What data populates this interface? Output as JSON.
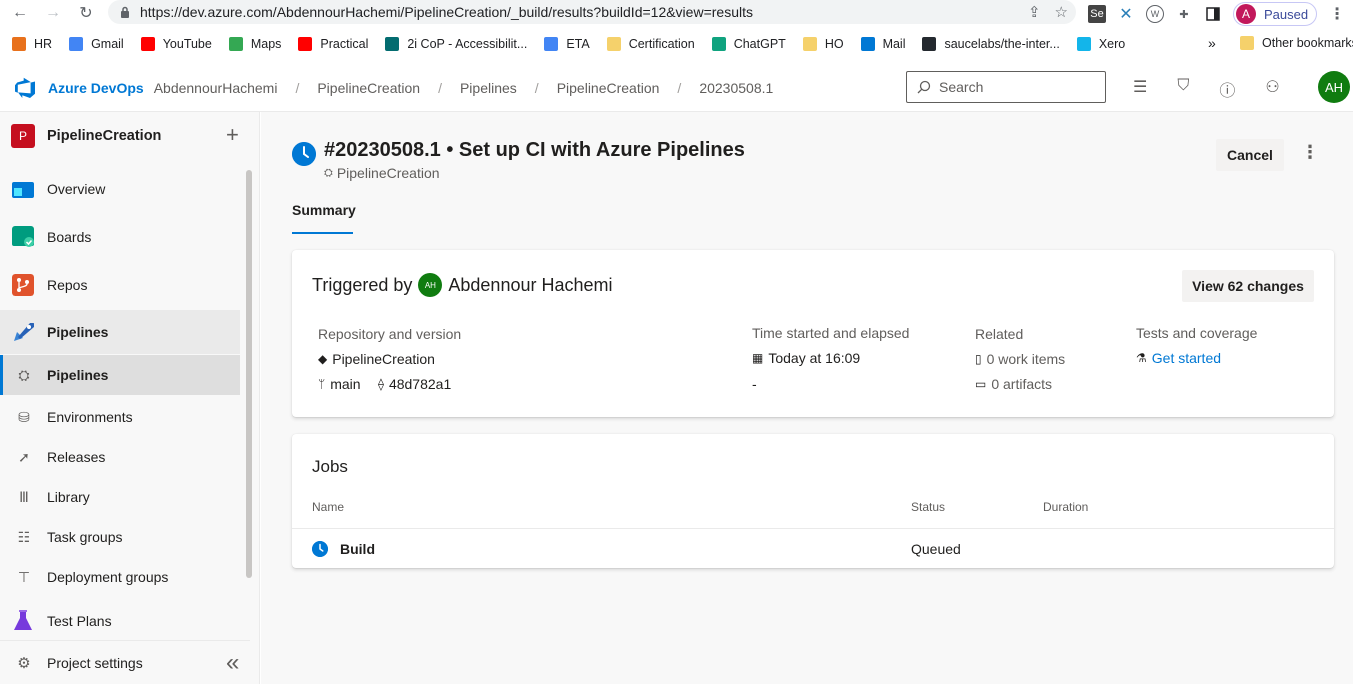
{
  "browser": {
    "url": "https://dev.azure.com/AbdennourHachemi/PipelineCreation/_build/results?buildId=12&view=results",
    "profile_initial": "A",
    "profile_status": "Paused",
    "bookmarks": [
      {
        "label": "HR",
        "color": "#e8711c"
      },
      {
        "label": "Gmail",
        "color": "#4285f4"
      },
      {
        "label": "YouTube",
        "color": "#ff0000"
      },
      {
        "label": "Maps",
        "color": "#34a853"
      },
      {
        "label": "Practical",
        "color": "#ff0000"
      },
      {
        "label": "2i CoP - Accessibilit...",
        "color": "#036c70"
      },
      {
        "label": "ETA",
        "color": "#4285f4"
      },
      {
        "label": "Certification",
        "color": "#f5d16b"
      },
      {
        "label": "ChatGPT",
        "color": "#10a37f"
      },
      {
        "label": "HO",
        "color": "#f5d16b"
      },
      {
        "label": "Mail",
        "color": "#0078d4"
      },
      {
        "label": "saucelabs/the-inter...",
        "color": "#24292f"
      },
      {
        "label": "Xero",
        "color": "#13b5ea"
      }
    ],
    "bookmarks_overflow": "»",
    "other_bookmarks": "Other bookmarks"
  },
  "header": {
    "brand": "Azure DevOps",
    "breadcrumbs": [
      "AbdennourHachemi",
      "PipelineCreation",
      "Pipelines",
      "PipelineCreation",
      "20230508.1"
    ],
    "search_placeholder": "Search",
    "avatar_initials": "AH",
    "avatar_color": "#107c10"
  },
  "sidebar": {
    "project_initial": "P",
    "project_name": "PipelineCreation",
    "add_symbol": "+",
    "items": [
      {
        "label": "Overview"
      },
      {
        "label": "Boards"
      },
      {
        "label": "Repos"
      },
      {
        "label": "Pipelines"
      }
    ],
    "sub_items": [
      {
        "label": "Pipelines"
      },
      {
        "label": "Environments"
      },
      {
        "label": "Releases"
      },
      {
        "label": "Library"
      },
      {
        "label": "Task groups"
      },
      {
        "label": "Deployment groups"
      }
    ],
    "test_plans": "Test Plans",
    "project_settings": "Project settings",
    "collapse_symbol": "«"
  },
  "run": {
    "title": "#20230508.1 • Set up CI with Azure Pipelines",
    "pipeline": "PipelineCreation",
    "cancel_label": "Cancel",
    "more_symbol": "⋮",
    "tab": "Summary"
  },
  "summary": {
    "triggered_prefix": "Triggered by",
    "trigger_initials": "AH",
    "trigger_user": "Abdennour Hachemi",
    "view_changes": "View 62 changes",
    "repo_label": "Repository and version",
    "repo_name": "PipelineCreation",
    "branch": "main",
    "commit": "48d782a1",
    "time_label": "Time started and elapsed",
    "time_started": "Today at 16:09",
    "elapsed": "-",
    "related_label": "Related",
    "work_items": "0 work items",
    "artifacts": "0 artifacts",
    "tests_label": "Tests and coverage",
    "get_started": "Get started"
  },
  "jobs": {
    "title": "Jobs",
    "columns": [
      "Name",
      "Status",
      "Duration"
    ],
    "rows": [
      {
        "name": "Build",
        "status": "Queued",
        "duration": ""
      }
    ]
  },
  "colors": {
    "accent": "#0078d4",
    "project_badge": "#c50f1f",
    "user_avatar": "#107c10"
  }
}
